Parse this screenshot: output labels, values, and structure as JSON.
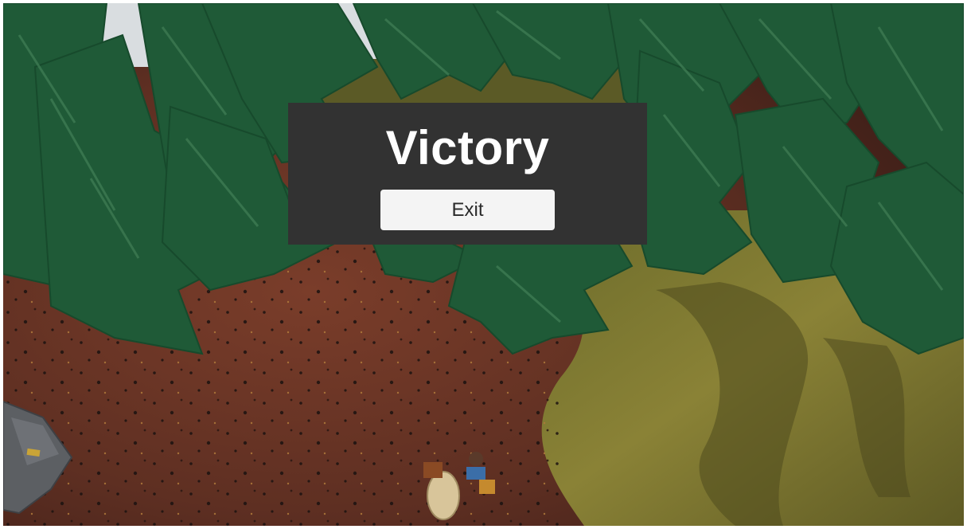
{
  "dialog": {
    "title": "Victory",
    "exit_label": "Exit"
  },
  "colors": {
    "panel_background": "#323232",
    "title_text": "#ffffff",
    "button_background": "#f4f4f4",
    "button_text": "#2a2a2a",
    "tree_foliage": "#1f5a37",
    "dirt_ground": "#6b3626",
    "grass_ground": "#6e6a2c",
    "sky": "#d9dde0"
  }
}
